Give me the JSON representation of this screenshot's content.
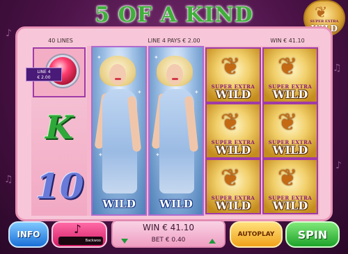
{
  "header": {
    "title": "5 OF A KIND",
    "badge_small": "SUPER EXTRA",
    "badge_big": "WILD"
  },
  "info_bar": {
    "lines": "40 LINES",
    "pays": "LINE 4 PAYS € 2.00",
    "win": "WIN € 41.10"
  },
  "reels": {
    "line_tag_line": "LINE 4",
    "line_tag_amount": "€ 2.00",
    "k_symbol": "K",
    "ten_symbol": "10",
    "wild_label": "WILD",
    "super_extra_label": "SUPER EXTRA",
    "super_wild_label": "WILD"
  },
  "controls": {
    "info_label": "INFO",
    "music_track": "Backwoo",
    "win_display": "WIN € 41.10",
    "bet_display": "BET € 0.40",
    "autoplay_label": "AUTOPLAY",
    "spin_label": "SPIN"
  },
  "colors": {
    "frame": "#f7c6d9",
    "title_green": "#3fae3a",
    "spin_green": "#1ea32a",
    "info_blue": "#1a6fd8",
    "autoplay_orange": "#f0a21a"
  }
}
